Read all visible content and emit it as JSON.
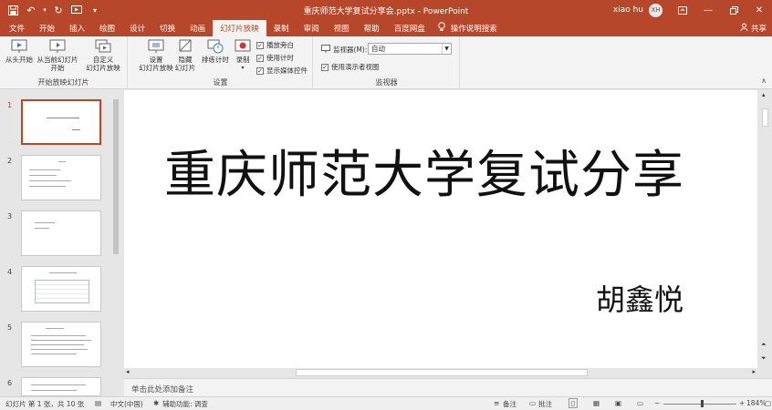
{
  "titlebar": {
    "document_title": "重庆师范大学复试分享会.pptx - PowerPoint",
    "user_name": "xiao hu",
    "user_initials": "XH"
  },
  "tabs": [
    "文件",
    "开始",
    "插入",
    "绘图",
    "设计",
    "切换",
    "动画",
    "幻灯片放映",
    "录制",
    "审阅",
    "视图",
    "帮助",
    "百度网盘"
  ],
  "active_tab": "幻灯片放映",
  "search_label": "操作说明搜索",
  "share_label": "共享",
  "ribbon": {
    "start_group": {
      "from_start": "从头开始",
      "from_current_l1": "从当前幻灯片",
      "from_current_l2": "开始",
      "custom_l1": "自定义",
      "custom_l2": "幻灯片放映",
      "label": "开始放映幻灯片"
    },
    "setup_group": {
      "setup_l1": "设置",
      "setup_l2": "幻灯片放映",
      "hide_l1": "隐藏",
      "hide_l2": "幻灯片",
      "rehearse": "排练计时",
      "record": "录制",
      "play_narrations": "播放旁白",
      "use_timings": "使用计时",
      "show_media_controls": "显示媒体控件",
      "label": "设置"
    },
    "monitors_group": {
      "monitor_label": "监视器(M):",
      "monitor_value": "自动",
      "presenter_view": "使用演示者视图",
      "label": "监视器"
    }
  },
  "slides": {
    "numbers": [
      "1",
      "2",
      "3",
      "4",
      "5",
      "6"
    ],
    "current": "1"
  },
  "slide": {
    "title": "重庆师范大学复试分享",
    "author": "胡鑫悦"
  },
  "notes_placeholder": "单击此处添加备注",
  "status": {
    "slide_info": "幻灯片 第 1 张，共 10 张",
    "language": "中文(中国)",
    "accessibility": "辅助功能: 调查",
    "notes": "备注",
    "comments": "批注",
    "zoom": "184%"
  },
  "colors": {
    "accent": "#b7472a",
    "ribbon_bg": "#f3f3f3",
    "pane_bg": "#e6e6e6"
  }
}
